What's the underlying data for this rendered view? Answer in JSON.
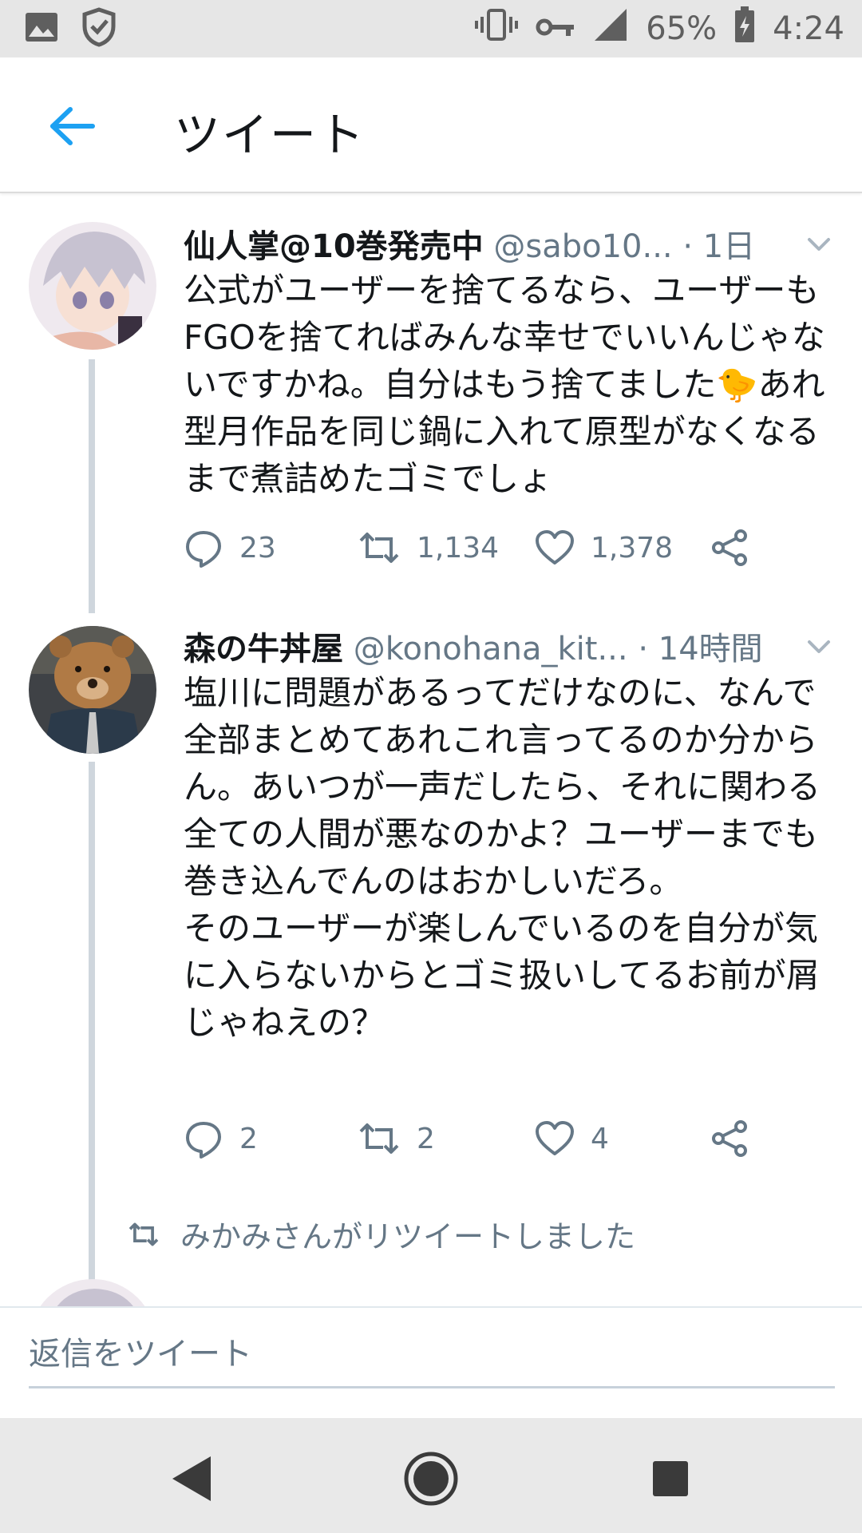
{
  "status_bar": {
    "battery": "65%",
    "time": "4:24"
  },
  "header": {
    "title": "ツイート"
  },
  "tweets": [
    {
      "name": "仙人掌@10巻発売中",
      "handle": "@sabo10...",
      "time": "· 1日",
      "text": "公式がユーザーを捨てるなら、ユーザーもFGOを捨てればみんな幸せでいいんじゃないですかね。自分はもう捨てました🐤あれ型月作品を同じ鍋に入れて原型がなくなるまで煮詰めたゴミでしょ",
      "replies": "23",
      "retweets": "1,134",
      "likes": "1,378"
    },
    {
      "name": "森の牛丼屋",
      "handle": "@konohana_kit...",
      "time": "· 14時間",
      "text": "塩川に問題があるってだけなのに、なんで全部まとめてあれこれ言ってるのか分からん。あいつが一声だしたら、それに関わる全ての人間が悪なのかよ？ユーザーまでも巻き込んでんのはおかしいだろ。\nそのユーザーが楽しんでいるのを自分が気に入らないからとゴミ扱いしてるお前が屑じゃねえの？",
      "replies": "2",
      "retweets": "2",
      "likes": "4"
    }
  ],
  "retweet_context": "みかみさんがリツイートしました",
  "reply_bar": {
    "placeholder": "返信をツイート"
  },
  "colors": {
    "accent": "#1da1f2",
    "secondary_text": "#657786",
    "thread_line": "#cfd6dd"
  }
}
